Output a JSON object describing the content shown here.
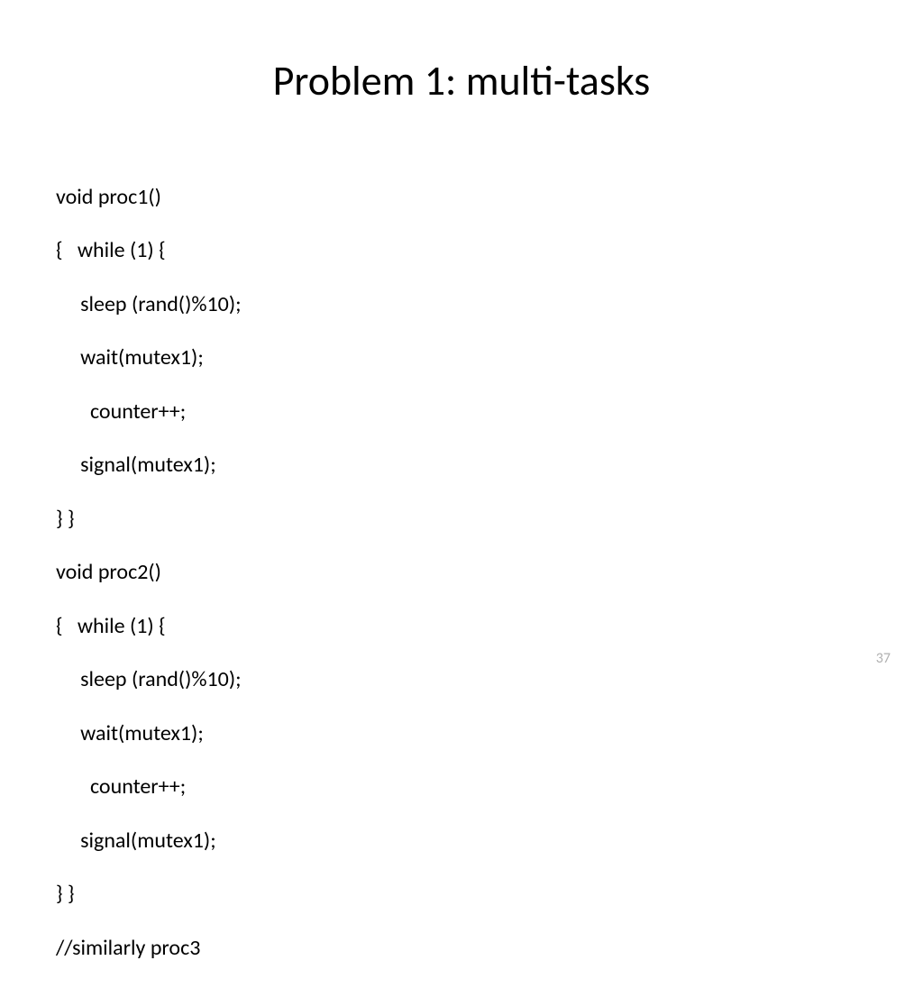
{
  "slide": {
    "title": "Problem 1: multi-tasks",
    "code_lines": [
      "void proc1()",
      "{   while (1) {",
      "     sleep (rand()%10);",
      "     wait(mutex1);",
      "       counter++;",
      "     signal(mutex1);",
      "} }",
      "void proc2()",
      "{   while (1) {",
      "     sleep (rand()%10);",
      "     wait(mutex1);",
      "       counter++;",
      "     signal(mutex1);",
      "} }",
      "//similarly proc3"
    ],
    "page_number": "37"
  }
}
